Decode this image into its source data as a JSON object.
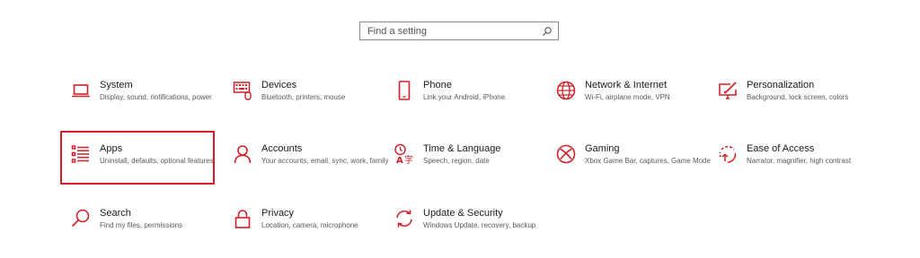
{
  "search": {
    "placeholder": "Find a setting",
    "icon": "search-icon"
  },
  "accent": "#d0202a",
  "tiles": {
    "system": {
      "title": "System",
      "desc": "Display, sound, notifications, power",
      "icon": "laptop-icon"
    },
    "devices": {
      "title": "Devices",
      "desc": "Bluetooth, printers, mouse",
      "icon": "keyboard-icon"
    },
    "phone": {
      "title": "Phone",
      "desc": "Link your Android, iPhone",
      "icon": "phone-icon"
    },
    "network": {
      "title": "Network & Internet",
      "desc": "Wi-Fi, airplane mode, VPN",
      "icon": "globe-icon"
    },
    "personalization": {
      "title": "Personalization",
      "desc": "Background, lock screen, colors",
      "icon": "paint-icon"
    },
    "apps": {
      "title": "Apps",
      "desc": "Uninstall, defaults, optional features",
      "icon": "apps-list-icon"
    },
    "accounts": {
      "title": "Accounts",
      "desc": "Your accounts, email, sync, work, family",
      "icon": "person-icon"
    },
    "time": {
      "title": "Time & Language",
      "desc": "Speech, region, date",
      "icon": "language-icon"
    },
    "gaming": {
      "title": "Gaming",
      "desc": "Xbox Game Bar, captures, Game Mode",
      "icon": "xbox-icon"
    },
    "ease": {
      "title": "Ease of Access",
      "desc": "Narrator, magnifier, high contrast",
      "icon": "ease-of-access-icon"
    },
    "search": {
      "title": "Search",
      "desc": "Find my files, permissions",
      "icon": "magnifier-icon"
    },
    "privacy": {
      "title": "Privacy",
      "desc": "Location, camera, microphone",
      "icon": "lock-icon"
    },
    "update": {
      "title": "Update & Security",
      "desc": "Windows Update, recovery, backup",
      "icon": "sync-icon"
    }
  }
}
